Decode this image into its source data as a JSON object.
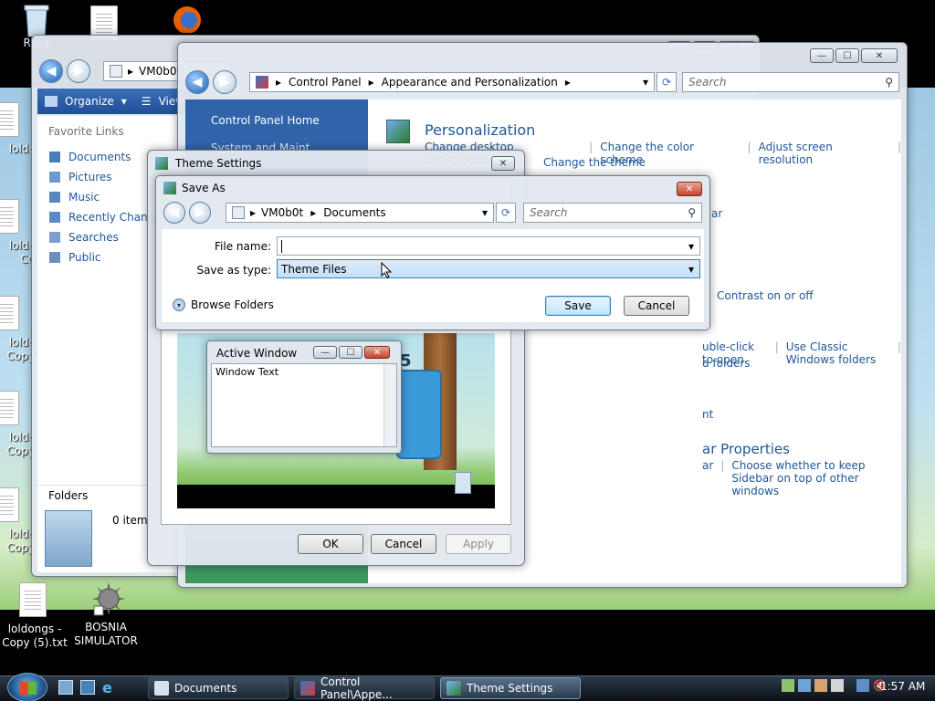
{
  "desktop": {
    "icons": [
      {
        "label": "Recy"
      },
      {
        "label": "loldc"
      },
      {
        "label": "loldc\nCo"
      },
      {
        "label": "loldc\nCopy"
      },
      {
        "label": "loldc\nCopy"
      },
      {
        "label": "loldc\nCopy"
      },
      {
        "label": "loldongs -\nCopy (5).txt"
      },
      {
        "label": "BOSNIA\nSIMULATOR"
      }
    ]
  },
  "explorer": {
    "address": "VM0b0t",
    "toolbar": {
      "organize": "Organize",
      "views": "View"
    },
    "favorites_header": "Favorite Links",
    "favorites": [
      "Documents",
      "Pictures",
      "Music",
      "Recently Change",
      "Searches",
      "Public"
    ],
    "folders_label": "Folders",
    "items_count": "0 item"
  },
  "control_panel": {
    "breadcrumb": [
      "Control Panel",
      "Appearance and Personalization"
    ],
    "search_placeholder": "Search",
    "sidebar_home": "Control Panel Home",
    "sidebar_partial": "System and Maint",
    "section_title": "Personalization",
    "links_row1": [
      "Change desktop background",
      "Change the color scheme",
      "Adjust screen resolution"
    ],
    "links_row2": [
      "Change the theme"
    ],
    "partial_links": {
      "ar": "ar",
      "contrast": "Contrast on or off",
      "dbl_click": "uble-click to open",
      "classic": "Use Classic Windows folders",
      "folders": "d folders",
      "nt": "nt",
      "sidebar_props": "ar Properties",
      "sidebar_ar": "ar",
      "sidebar_top": "Choose whether to keep Sidebar on top of other windows"
    }
  },
  "theme_settings": {
    "title": "Theme Settings",
    "preview": {
      "active_window": "Active Window",
      "window_text": "Window Text"
    },
    "buttons": {
      "ok": "OK",
      "cancel": "Cancel",
      "apply": "Apply"
    }
  },
  "save_as": {
    "title": "Save As",
    "breadcrumb": [
      "VM0b0t",
      "Documents"
    ],
    "search_placeholder": "Search",
    "file_name_label": "File name:",
    "file_name_value": "",
    "save_type_label": "Save as type:",
    "save_type_value": "Theme Files",
    "browse_folders": "Browse Folders",
    "buttons": {
      "save": "Save",
      "cancel": "Cancel"
    }
  },
  "taskbar": {
    "tasks": [
      "Documents",
      "Control Panel\\Appe...",
      "Theme Settings"
    ],
    "clock": "1:57 AM"
  }
}
